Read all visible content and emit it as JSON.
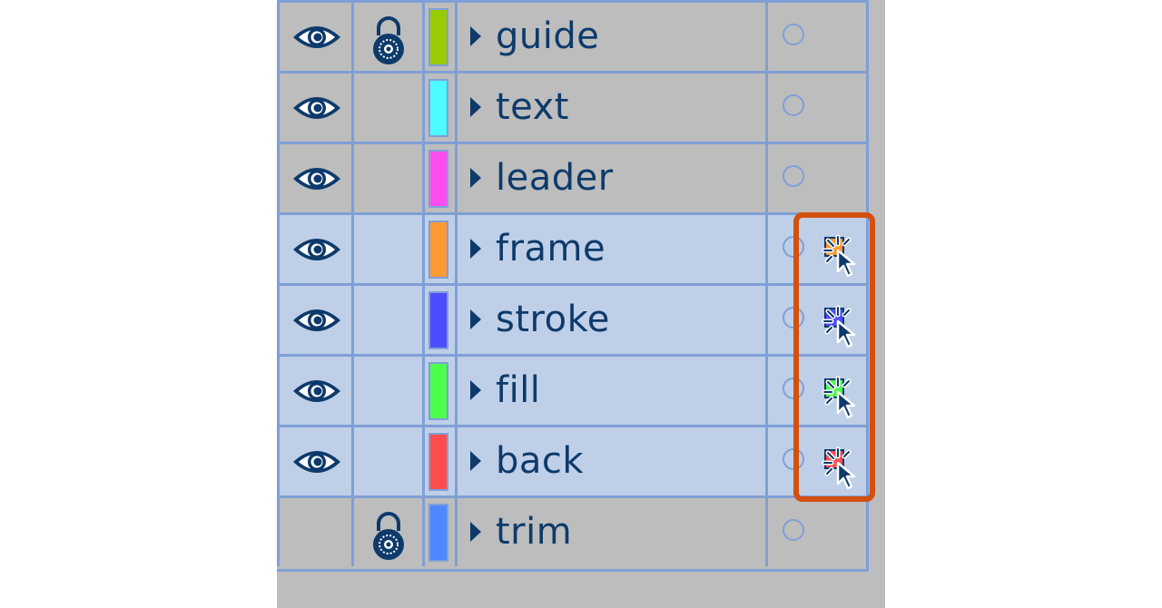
{
  "layers": [
    {
      "name": "guide",
      "visible": true,
      "locked": true,
      "color": "#99cc00",
      "selected": false,
      "has_selection": false
    },
    {
      "name": "text",
      "visible": true,
      "locked": false,
      "color": "#4dfcff",
      "selected": false,
      "has_selection": false
    },
    {
      "name": "leader",
      "visible": true,
      "locked": false,
      "color": "#ff4df2",
      "selected": false,
      "has_selection": false
    },
    {
      "name": "frame",
      "visible": true,
      "locked": false,
      "color": "#ff9933",
      "selected": true,
      "has_selection": true
    },
    {
      "name": "stroke",
      "visible": true,
      "locked": false,
      "color": "#4d4dff",
      "selected": true,
      "has_selection": true
    },
    {
      "name": "fill",
      "visible": true,
      "locked": false,
      "color": "#4dff4d",
      "selected": true,
      "has_selection": true
    },
    {
      "name": "back",
      "visible": true,
      "locked": false,
      "color": "#ff4d4d",
      "selected": true,
      "has_selection": true
    },
    {
      "name": "trim",
      "visible": false,
      "locked": true,
      "color": "#4d88ff",
      "selected": false,
      "has_selection": false
    }
  ],
  "colors": {
    "grid_line": "#7f9fd6",
    "panel_bg": "#bdbdbd",
    "selected_row_bg": "#bfcfe7",
    "text": "#0d3a6b",
    "highlight_border": "#d4500e"
  },
  "icons": {
    "visibility": "eye-icon",
    "lock": "padlock-icon",
    "expand": "disclosure-triangle-icon",
    "target": "target-circle-icon",
    "selection": "selected-art-cursor-icon"
  }
}
